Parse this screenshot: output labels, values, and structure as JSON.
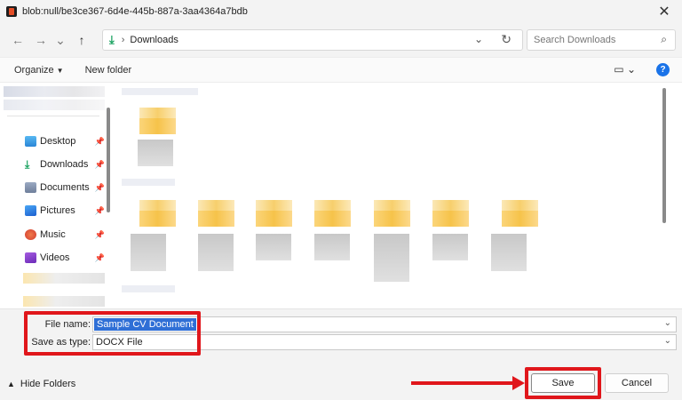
{
  "window": {
    "title": "blob:null/be3ce367-6d4e-445b-887a-3aa4364a7bdb",
    "close_glyph": "✕"
  },
  "nav": {
    "back": "←",
    "forward": "→",
    "history": "⌄",
    "up": "↑"
  },
  "address": {
    "icon": "download-icon",
    "separator": "›",
    "path": "Downloads",
    "dropdown": "⌄",
    "refresh": "↻"
  },
  "search": {
    "placeholder": "Search Downloads",
    "icon": "search-icon"
  },
  "commands": {
    "organize": "Organize",
    "new_folder": "New folder"
  },
  "sidebar": {
    "items": [
      {
        "label": "Desktop",
        "icon": "desktop-icon",
        "color": "#3aa0e8"
      },
      {
        "label": "Downloads",
        "icon": "download-icon",
        "color": "#1aa260"
      },
      {
        "label": "Documents",
        "icon": "documents-icon",
        "color": "#7a8aa6"
      },
      {
        "label": "Pictures",
        "icon": "pictures-icon",
        "color": "#2b7de9"
      },
      {
        "label": "Music",
        "icon": "music-icon",
        "color": "#e2563f"
      },
      {
        "label": "Videos",
        "icon": "videos-icon",
        "color": "#8a3fd1"
      }
    ]
  },
  "form": {
    "file_name_label": "File name:",
    "file_name_value": "Sample CV Document",
    "save_type_label": "Save as type:",
    "save_type_value": "DOCX File"
  },
  "footer": {
    "hide_folders": "Hide Folders",
    "save_label": "Save",
    "cancel_label": "Cancel"
  },
  "colors": {
    "accent": "#1a73e8",
    "annotation": "#e0161b",
    "selection": "#2f6fd6"
  }
}
